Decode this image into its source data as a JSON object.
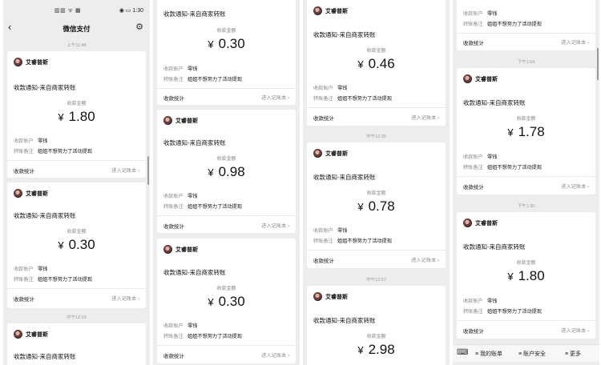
{
  "status": {
    "right": "◉ ▭ 1:30",
    "icons": "▥▥ ᯤ ▦"
  },
  "nav": {
    "title": "微信支付"
  },
  "labels": {
    "notify_title": "收款通知-来自商家转账",
    "amount_label": "收款金额",
    "account_key": "收款账户",
    "remark_key": "转账备注",
    "stats": "收款统计",
    "ledger": "进入记账本 ›",
    "yen": "¥"
  },
  "cards": [
    {
      "sender": "艾睿普斯",
      "amount": "1.80",
      "account": "零钱",
      "remark": "姐姐不想努力了活动提现"
    },
    {
      "sender": "艾睿普斯",
      "amount": "0.30",
      "account": "零钱",
      "remark": "姐姐不想努力了活动提现"
    },
    {
      "sender": "艾睿普斯"
    },
    {
      "sender": "",
      "amount": "0.30",
      "account": "零钱",
      "remark": "姐姐不想努力了活动提现"
    },
    {
      "sender": "艾睿普斯",
      "amount": "0.98",
      "account": "零钱",
      "remark": "姐姐不想努力了活动提现"
    },
    {
      "sender": "艾睿普斯",
      "amount": "0.30",
      "account": "零钱",
      "remark": "姐姐不想努力了活动提现"
    },
    {
      "sender": "艾睿普斯",
      "amount": "0.46",
      "account": "零钱",
      "remark": "姐姐不想努力了活动提现"
    },
    {
      "sender": "艾睿普斯",
      "amount": "0.78",
      "account": "零钱",
      "remark": "姐姐不想努力了活动提现"
    },
    {
      "sender": "艾睿普斯",
      "amount": "2.98"
    },
    {
      "account": "零钱",
      "remark": "姐姐不想努力了活动提现"
    },
    {
      "sender": "艾睿普斯",
      "amount": "1.78",
      "account": "零钱",
      "remark": "姐姐不想努力了活动提现"
    },
    {
      "sender": "艾睿普斯",
      "amount": "1.80",
      "account": "零钱",
      "remark": "姐姐不想努力了活动提现"
    }
  ],
  "timestamps": [
    "上午11:48",
    "中午12:15",
    "中午12:39",
    "中午12:57",
    "下午1:04",
    "下午1:30"
  ],
  "bottom_bar": {
    "keyboard_icon": "keyboard-icon",
    "items": [
      "≡ 我的账单",
      "≡ 账户安全",
      "≡ 更多"
    ]
  },
  "colors": {
    "background": "#ededed",
    "card": "#ffffff",
    "muted": "#8a8a8a"
  }
}
